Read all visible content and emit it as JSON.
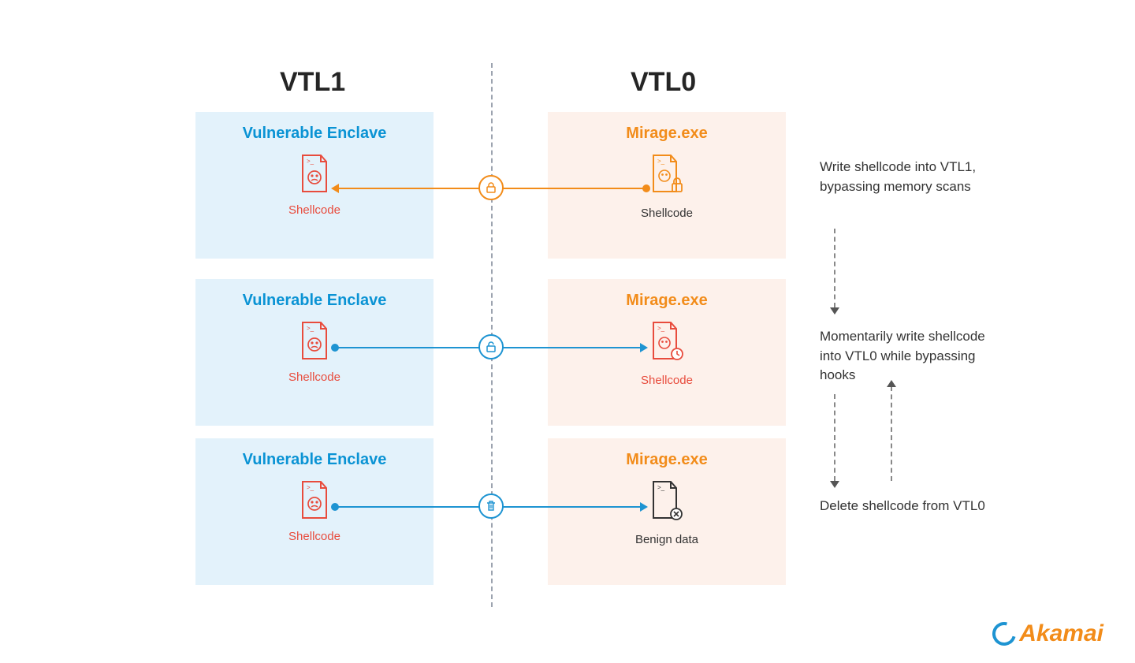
{
  "columns": {
    "left": "VTL1",
    "right": "VTL0"
  },
  "cards": {
    "enclave_title": "Vulnerable Enclave",
    "mirage_title": "Mirage.exe",
    "shellcode": "Shellcode",
    "benign": "Benign data"
  },
  "steps": {
    "s1": "Write shellcode into VTL1, bypassing memory scans",
    "s2": "Momentarily write shellcode into VTL0 while bypassing hooks",
    "s3": "Delete shellcode from VTL0"
  },
  "logo": "Akamai"
}
